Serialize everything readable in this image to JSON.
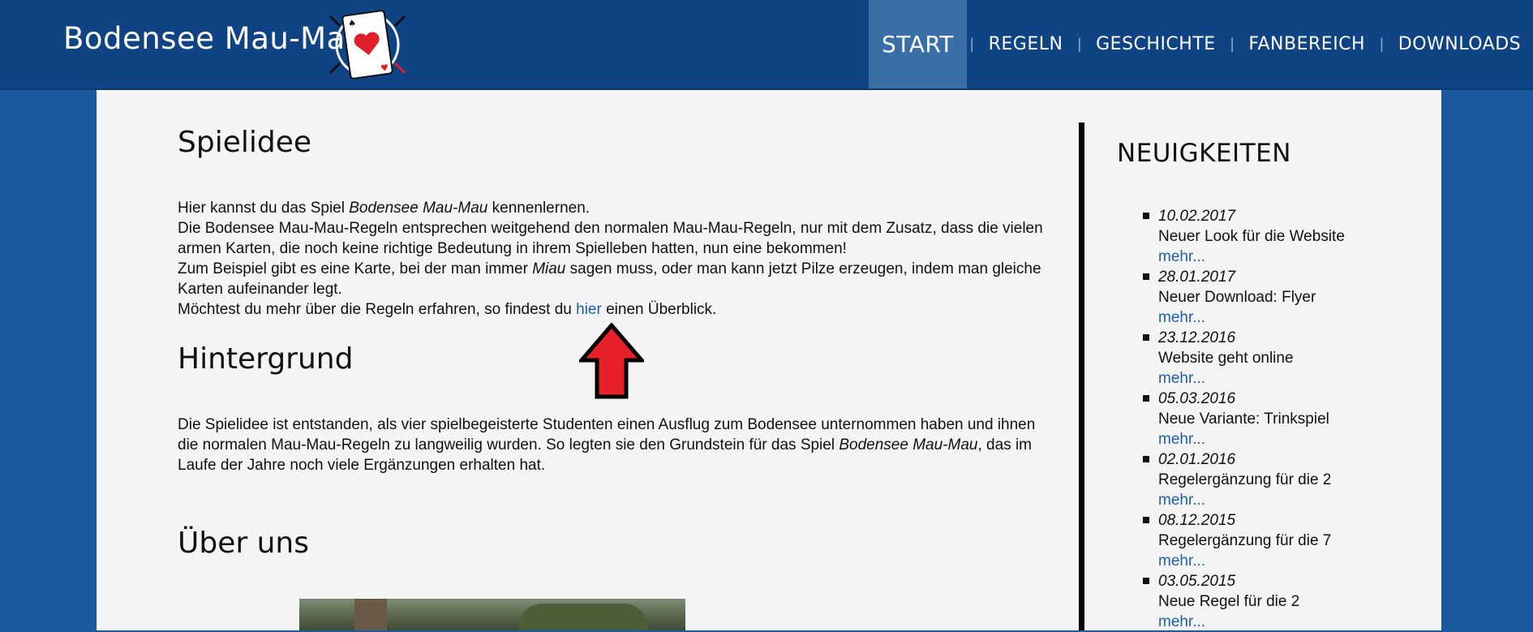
{
  "header": {
    "site_title": "Bodensee Mau-Mau",
    "colors": {
      "header_bg": "#0f4383",
      "page_bg": "#1c5aa0",
      "active_nav_bg": "#3a6ea6",
      "link": "#1f5fa6"
    },
    "logo_icon": "playing-card-heart-icon"
  },
  "nav": {
    "items": [
      {
        "label": "START",
        "active": true
      },
      {
        "label": "REGELN"
      },
      {
        "label": "GESCHICHTE"
      },
      {
        "label": "FANBEREICH"
      },
      {
        "label": "DOWNLOADS"
      }
    ],
    "separator": "|"
  },
  "main": {
    "spielidee": {
      "title": "Spielidee",
      "l1_pre": "Hier kannst du das Spiel ",
      "l1_em": "Bodensee Mau-Mau",
      "l1_post": " kennenlernen.",
      "l2": "Die Bodensee Mau-Mau-Regeln entsprechen weitgehend den normalen Mau-Mau-Regeln, nur mit dem Zusatz, dass die vielen armen Karten, die noch keine richtige Bedeutung in ihrem Spielleben hatten, nun eine bekommen!",
      "l3_pre": "Zum Beispiel gibt es eine Karte, bei der man immer ",
      "l3_em": "Miau",
      "l3_post": " sagen muss, oder man kann jetzt Pilze erzeugen, indem man gleiche Karten aufeinander legt.",
      "l4_pre": "Möchtest du mehr über die Regeln erfahren, so findest du ",
      "l4_link": "hier",
      "l4_post": " einen Überblick."
    },
    "hintergrund": {
      "title": "Hintergrund",
      "pre": "Die Spielidee ist entstanden, als vier spielbegeisterte Studenten einen Ausflug zum Bodensee unternommen haben und ihnen die normalen Mau-Mau-Regeln zu langweilig wurden. So legten sie den Grundstein für das Spiel ",
      "em": "Bodensee Mau-Mau",
      "post": ", das im Laufe der Jahre noch viele Ergänzungen erhalten hat."
    },
    "ueber_uns": {
      "title": "Über uns"
    }
  },
  "sidebar": {
    "title": "NEUIGKEITEN",
    "more_label": "mehr...",
    "news": [
      {
        "date": "10.02.2017",
        "text": "Neuer Look für die Website"
      },
      {
        "date": "28.01.2017",
        "text": "Neuer Download: Flyer"
      },
      {
        "date": "23.12.2016",
        "text": "Website geht online"
      },
      {
        "date": "05.03.2016",
        "text": "Neue Variante: Trinkspiel"
      },
      {
        "date": "02.01.2016",
        "text": "Regelergänzung für die 2"
      },
      {
        "date": "08.12.2015",
        "text": "Regelergänzung für die 7"
      },
      {
        "date": "03.05.2015",
        "text": "Neue Regel für die 2"
      }
    ]
  }
}
